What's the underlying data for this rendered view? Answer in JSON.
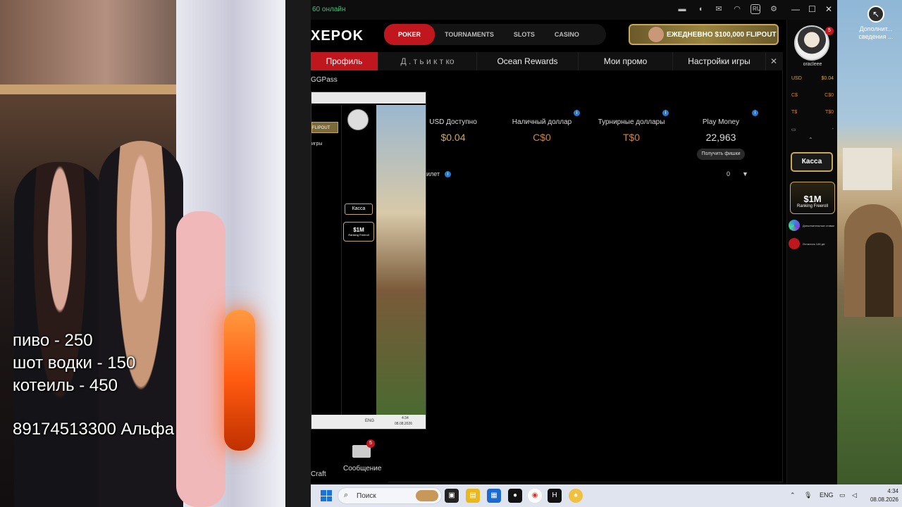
{
  "overlay": {
    "line1": "пиво - 250",
    "line2": "шот водки - 150",
    "line3": "котеиль - 450",
    "line4": "89174513300 Альфа"
  },
  "client": {
    "online_status": "60 онлайн",
    "brand": "XEPOK",
    "lang": "RU",
    "nav": {
      "poker": "POKER",
      "tournaments": "TOURNAMENTS",
      "slots": "SLOTS",
      "casino": "CASINO"
    },
    "promo_banner": "ЕЖЕДНЕВНО $100,000 FLIPOUT",
    "tabs": {
      "profile": "Профиль",
      "achievements": "Д  .  т  ь  и  к  т  ко",
      "ocean_rewards": "Ocean Rewards",
      "my_promos": "Мои промо",
      "game_settings": "Настройки игры"
    },
    "ggpass": "GGPass",
    "balances": [
      {
        "label": "USD Доступно",
        "value": "$0.04",
        "color": "#d4a94a"
      },
      {
        "label": "Наличный доллар",
        "value": "C$0",
        "color": "#d4843a"
      },
      {
        "label": "Турнирные доллары",
        "value": "T$0",
        "color": "#d4843a"
      },
      {
        "label": "Play Money",
        "value": "22,963",
        "color": "#dddddd"
      }
    ],
    "get_chips": "Получить фишки",
    "ticket_label": "илет",
    "ticket_value": "0",
    "craft_label": "Craft",
    "message_label": "Сообщение",
    "message_count": "5"
  },
  "account": {
    "username": "oracleee",
    "notification_count": "5",
    "rows": [
      {
        "currency": "USD",
        "amount": "$0.04"
      },
      {
        "currency": "C$",
        "amount": "C$0"
      },
      {
        "currency": "T$",
        "amount": "T$0"
      }
    ],
    "cashier_label": "Касса",
    "freeroll_amount": "$1M",
    "freeroll_label": "Ranking Freeroll",
    "side_item_1": "Дополнительные ставки",
    "side_item_2": "Осталось 146 дн."
  },
  "nested": {
    "flipout": "FLIPOUT",
    "games": "игры",
    "kassa": "Касса",
    "freeroll_amount": "$1M",
    "freeroll_label": "Ranking Freeroll",
    "lang": "ENG",
    "time": "4:34",
    "date": "08.08.2026"
  },
  "desktop": {
    "icon_label": "Дополнит... сведения ..."
  },
  "taskbar": {
    "search_placeholder": "Поиск",
    "lang": "ENG",
    "time": "4:34",
    "date": "08.08.2026"
  }
}
